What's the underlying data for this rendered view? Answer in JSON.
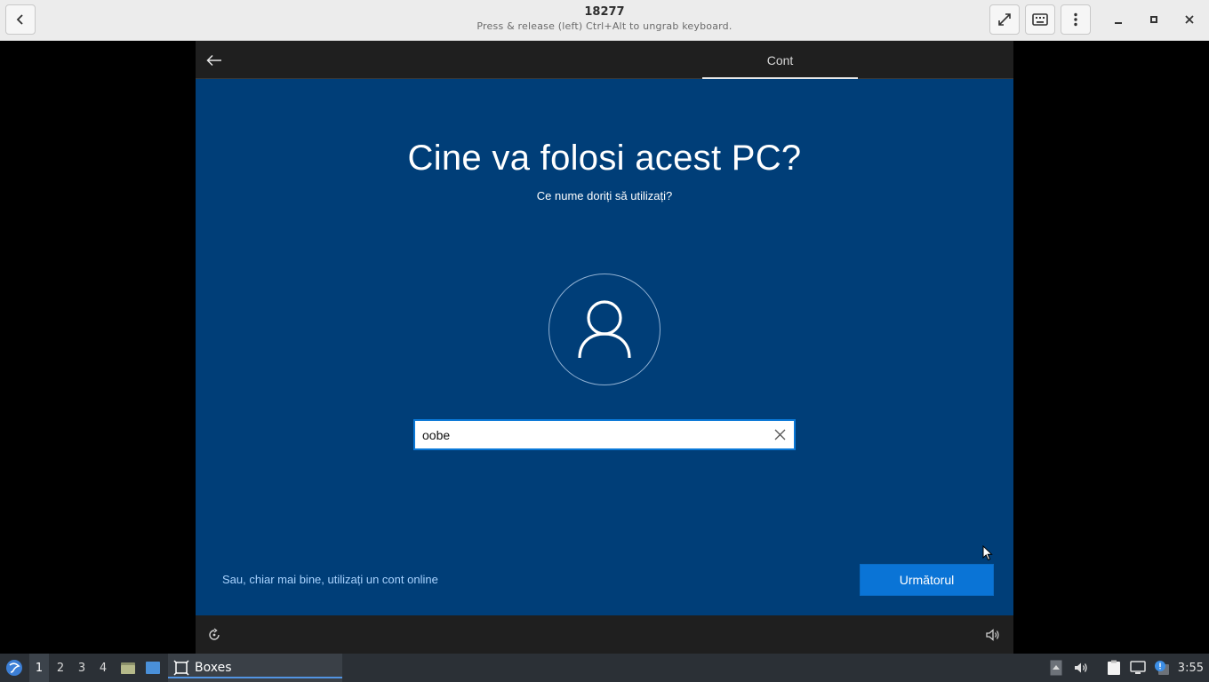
{
  "window": {
    "title": "18277",
    "subtitle": "Press & release (left) Ctrl+Alt to ungrab keyboard."
  },
  "guest": {
    "tab_label": "Cont",
    "heading": "Cine va folosi acest PC?",
    "subheading": "Ce nume doriți să utilizați?",
    "name_input_value": "oobe",
    "online_account_link": "Sau, chiar mai bine, utilizați un cont online",
    "next_button": "Următorul"
  },
  "taskbar": {
    "workspaces": [
      "1",
      "2",
      "3",
      "4"
    ],
    "active_workspace": "1",
    "app_label": "Boxes",
    "clock": "3:55"
  },
  "colors": {
    "oobe_background": "#003e78",
    "accent_button": "#0a74d6",
    "link": "#a9d3ff"
  }
}
